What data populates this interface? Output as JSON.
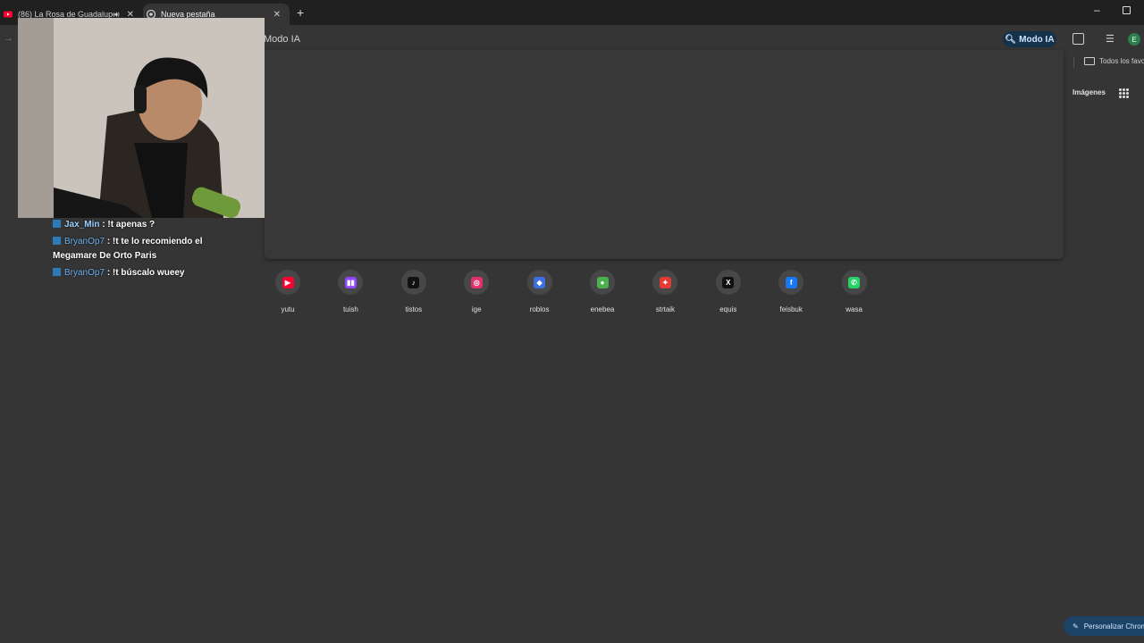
{
  "tabs": [
    {
      "title": "(86) La Rosa de Guadalupe",
      "active": false,
      "favicon": "youtube-icon",
      "audio": true
    },
    {
      "title": "Nueva pestaña",
      "active": true,
      "favicon": "chrome-icon"
    }
  ],
  "toolbar": {
    "omnibox_mode": "Modo IA",
    "ai_mode_button": "Modo IA"
  },
  "bookmarks": {
    "all_bookmarks": "Todos los favo"
  },
  "google": {
    "images_link": "Imágenes"
  },
  "chat": [
    {
      "user": "Jax_Min",
      "message": ": !t apenas ?",
      "user_style": "strong"
    },
    {
      "user": "BryanOp7",
      "message": ": !t te lo recomiendo el Megamare De Orto Paris",
      "user_style": "normal"
    },
    {
      "user": "BryanOp7",
      "message": ": !t búscalo wueey",
      "user_style": "normal"
    }
  ],
  "shortcuts": [
    {
      "label": "yutu",
      "icon": "youtube-icon",
      "color": "#ff0033",
      "glyph": "▶"
    },
    {
      "label": "tuish",
      "icon": "twitch-icon",
      "color": "#9146ff",
      "glyph": "▮▮"
    },
    {
      "label": "tistos",
      "icon": "tiktok-icon",
      "color": "#111111",
      "glyph": "♪"
    },
    {
      "label": "ige",
      "icon": "instagram-icon",
      "color": "#e1306c",
      "glyph": "◎"
    },
    {
      "label": "roblos",
      "icon": "roblox-icon",
      "color": "#3b6fe0",
      "glyph": "◆"
    },
    {
      "label": "enebea",
      "icon": "nba-icon",
      "color": "#4caf50",
      "glyph": "●"
    },
    {
      "label": "strtaik",
      "icon": "strike-icon",
      "color": "#e53935",
      "glyph": "✦"
    },
    {
      "label": "equis",
      "icon": "x-icon",
      "color": "#111111",
      "glyph": "X"
    },
    {
      "label": "feisbuk",
      "icon": "facebook-icon",
      "color": "#1877f2",
      "glyph": "f"
    },
    {
      "label": "wasa",
      "icon": "whatsapp-icon",
      "color": "#25d366",
      "glyph": "✆"
    }
  ],
  "customize_button": "Personalizar Chrom"
}
